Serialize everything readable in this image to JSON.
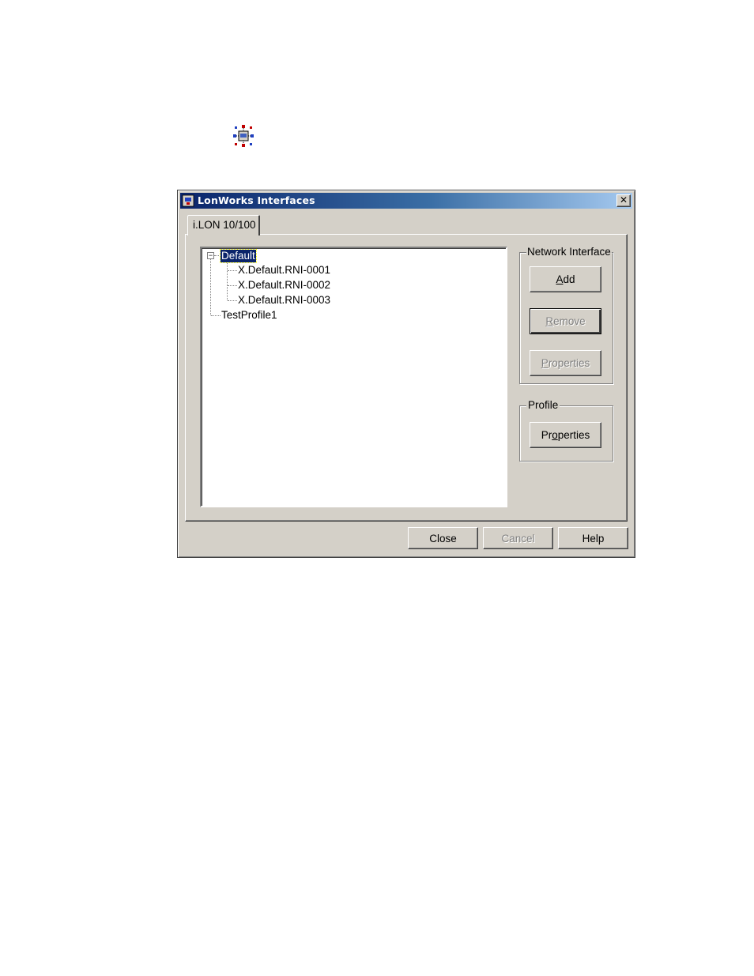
{
  "dialog": {
    "title": "LonWorks Interfaces",
    "close_glyph": "✕",
    "tab_label": "i.LON 10/100"
  },
  "tree": {
    "root": {
      "label": "Default",
      "expander": "−"
    },
    "children": [
      {
        "label": "X.Default.RNI-0001"
      },
      {
        "label": "X.Default.RNI-0002"
      },
      {
        "label": "X.Default.RNI-0003"
      }
    ],
    "sibling": {
      "label": "TestProfile1"
    }
  },
  "network_interface": {
    "group_label": "Network Interface",
    "add": {
      "pre": "",
      "accel": "A",
      "post": "dd"
    },
    "remove": {
      "pre": "",
      "accel": "R",
      "post": "emove"
    },
    "properties": {
      "pre": "",
      "accel": "P",
      "post": "roperties"
    }
  },
  "profile": {
    "group_label": "Profile",
    "properties": {
      "pre": "Pr",
      "accel": "o",
      "post": "perties"
    }
  },
  "footer": {
    "close": "Close",
    "cancel": "Cancel",
    "help": "Help"
  },
  "icons": {
    "top_icon": "network-node-icon",
    "title_icon": "lonworks-app-icon"
  },
  "colors": {
    "titlebar_start": "#0a246a",
    "titlebar_end": "#a6caf0",
    "face": "#d4d0c8",
    "selection": "#0a246a"
  }
}
